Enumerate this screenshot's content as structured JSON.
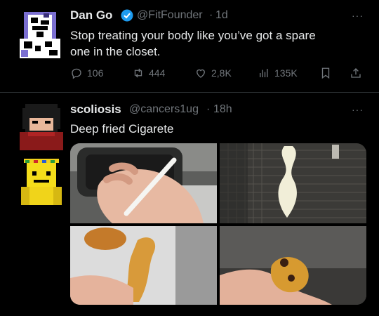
{
  "tweet1": {
    "author": "Dan Go",
    "handle": "@FitFounder",
    "separator": "·",
    "time": "1d",
    "text_line1": "Stop treating your body like you’ve got a spare",
    "text_line2": "one in the closet.",
    "more": "···",
    "actions": {
      "replies": "106",
      "reposts": "444",
      "likes": "2,8K",
      "views": "135K"
    }
  },
  "tweet2": {
    "author": "scoliosis",
    "handle": "@cancers1ug",
    "separator": "·",
    "time": "18h",
    "text": "Deep fried Cigarete",
    "more": "···"
  },
  "icons": {
    "verified": "verified-badge-icon",
    "reply": "reply-icon",
    "repost": "repost-icon",
    "like": "heart-icon",
    "views": "views-icon",
    "bookmark": "bookmark-icon",
    "share": "share-icon"
  },
  "colors": {
    "background": "#000000",
    "text": "#e7e9ea",
    "muted": "#71767b",
    "verified": "#1d9bf0",
    "divider": "#2f3336"
  }
}
